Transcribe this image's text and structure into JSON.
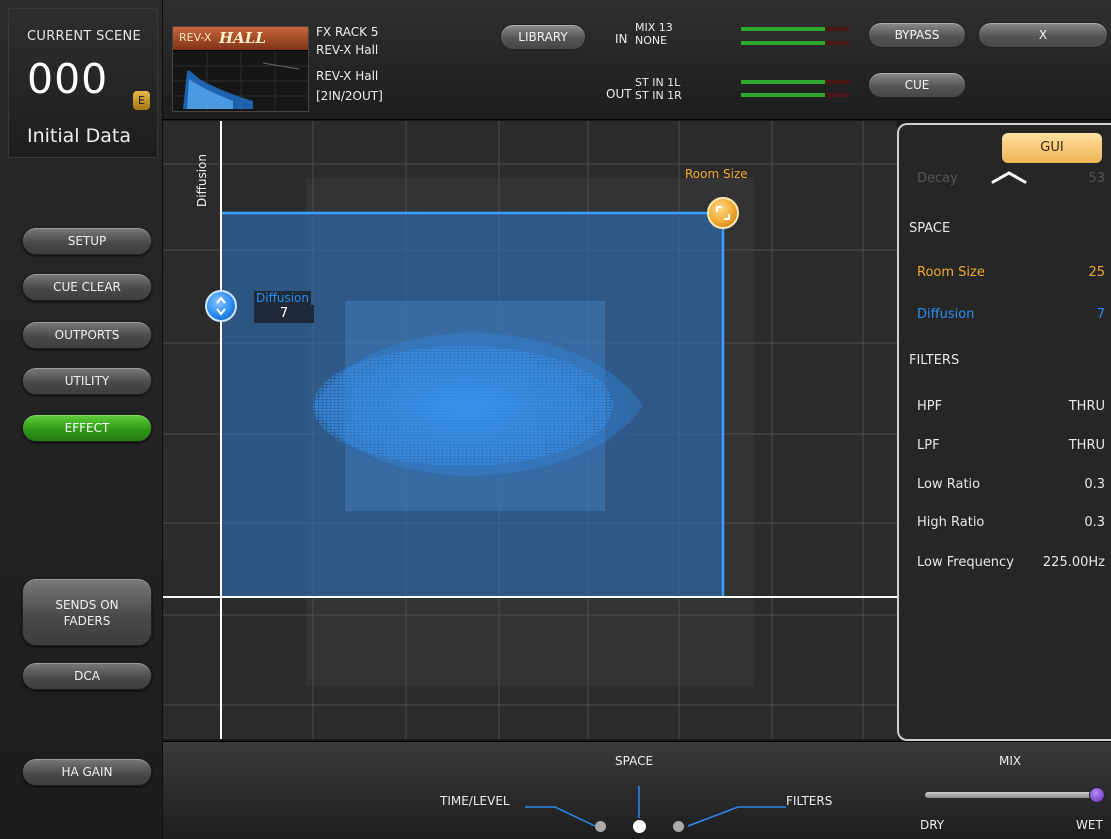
{
  "scene": {
    "label": "CURRENT SCENE",
    "number": "000",
    "badge": "E",
    "name": "Initial Data"
  },
  "sidebar": {
    "buttons": [
      {
        "label": "SETUP",
        "active": false
      },
      {
        "label": "CUE CLEAR",
        "active": false
      },
      {
        "label": "OUTPORTS",
        "active": false
      },
      {
        "label": "UTILITY",
        "active": false
      },
      {
        "label": "EFFECT",
        "active": true
      }
    ],
    "sends_on_faders": "SENDS ON\nFADERS",
    "dca": "DCA",
    "ha_gain": "HA GAIN"
  },
  "header": {
    "thumb_brand": "REV-X",
    "thumb_title": "HALL",
    "rack": "FX RACK 5",
    "effect_name": "REV-X Hall",
    "effect_type": "REV-X Hall",
    "io_config": "[2IN/2OUT]",
    "library_label": "LIBRARY",
    "in_label": "IN",
    "in_sources": [
      "MIX 13",
      "NONE"
    ],
    "out_label": "OUT",
    "out_sources": [
      "ST IN 1L",
      "ST IN 1R"
    ],
    "bypass_label": "BYPASS",
    "close_label": "X",
    "cue_label": "CUE",
    "in_meter_levels": [
      0.78,
      0.78
    ],
    "out_meter_levels": [
      0.78,
      0.78
    ]
  },
  "graph": {
    "y_axis_label": "Diffusion",
    "room_size_label": "Room Size",
    "diffusion_label": "Diffusion",
    "diffusion_value": "7",
    "room_color": "#f0a830",
    "diffusion_color": "#2a8cf0"
  },
  "panel": {
    "gui_label": "GUI",
    "scroll_hint_label": "Decay",
    "scroll_hint_value": "53",
    "space_header": "SPACE",
    "space_params": [
      {
        "name": "Room Size",
        "value": "25",
        "color": "#f0a830"
      },
      {
        "name": "Diffusion",
        "value": "7",
        "color": "#2a8cf0"
      }
    ],
    "filters_header": "FILTERS",
    "filter_params": [
      {
        "name": "HPF",
        "value": "THRU"
      },
      {
        "name": "LPF",
        "value": "THRU"
      },
      {
        "name": "Low Ratio",
        "value": "0.3"
      },
      {
        "name": "High Ratio",
        "value": "0.3"
      },
      {
        "name": "Low Frequency",
        "value": "225.00Hz"
      }
    ]
  },
  "bottom": {
    "page_title": "SPACE",
    "page_left": "TIME/LEVEL",
    "page_right": "FILTERS",
    "mix_label": "MIX",
    "dry_label": "DRY",
    "wet_label": "WET",
    "mix_level": 1.0
  }
}
